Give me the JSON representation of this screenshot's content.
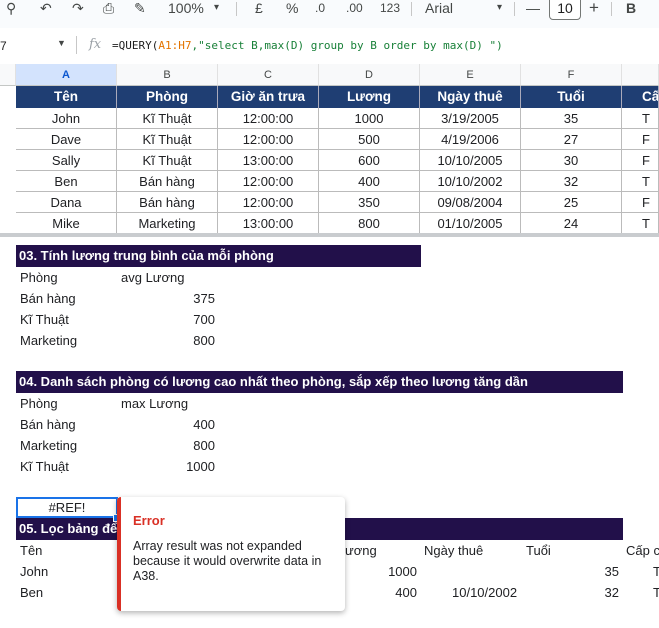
{
  "toolbar": {
    "zoom": "100%",
    "currency": "£",
    "percent": "%",
    "dec_decrease": ".0",
    "dec_increase": ".00",
    "number_format": "123",
    "font": "Arial",
    "font_size": "10",
    "minus": "—",
    "plus": "+",
    "bold": "B"
  },
  "formula_bar": {
    "name_box": "7",
    "fx": "fx",
    "formula_prefix": "=QUERY(",
    "formula_range": "A1:H7",
    "formula_string": ",\"select B,max(D) group by B order by max(D) \")"
  },
  "columns": [
    "A",
    "B",
    "C",
    "D",
    "E",
    "F"
  ],
  "table": {
    "headers": [
      "Tên",
      "Phòng",
      "Giờ ăn trưa",
      "Lương",
      "Ngày thuê",
      "Tuổi",
      "Cấ"
    ],
    "rows": [
      [
        "John",
        "Kĩ Thuật",
        "12:00:00",
        "1000",
        "3/19/2005",
        "35",
        "T"
      ],
      [
        "Dave",
        "Kĩ Thuật",
        "12:00:00",
        "500",
        "4/19/2006",
        "27",
        "F"
      ],
      [
        "Sally",
        "Kĩ Thuật",
        "13:00:00",
        "600",
        "10/10/2005",
        "30",
        "F"
      ],
      [
        "Ben",
        "Bán hàng",
        "12:00:00",
        "400",
        "10/10/2002",
        "32",
        "T"
      ],
      [
        "Dana",
        "Bán hàng",
        "12:00:00",
        "350",
        "09/08/2004",
        "25",
        "F"
      ],
      [
        "Mike",
        "Marketing",
        "13:00:00",
        "800",
        "01/10/2005",
        "24",
        "T"
      ]
    ]
  },
  "section3": {
    "title": "03. Tính lương trung bình của mỗi phòng",
    "col1": "Phòng",
    "col2": "avg Lương",
    "rows": [
      [
        "Bán hàng",
        "375"
      ],
      [
        "Kĩ Thuật",
        "700"
      ],
      [
        "Marketing",
        "800"
      ]
    ]
  },
  "section4": {
    "title": "04. Danh sách phòng có lương cao nhất theo phòng, sắp xếp theo lương tăng dần",
    "col1": "Phòng",
    "col2": "max Lương",
    "rows": [
      [
        "Bán hàng",
        "400"
      ],
      [
        "Marketing",
        "800"
      ],
      [
        "Kĩ Thuật",
        "1000"
      ]
    ]
  },
  "ref_cell": "#REF!",
  "section5": {
    "title": "05. Lọc bảng để",
    "headers": [
      "Tên",
      "ương",
      "Ngày thuê",
      "Tuổi",
      "Cấp c"
    ],
    "rows": [
      [
        "John",
        "1000",
        "",
        "35",
        "T"
      ],
      [
        "Ben",
        "400",
        "10/10/2002",
        "32",
        "T"
      ]
    ]
  },
  "error_popup": {
    "title": "Error",
    "message": "Array result was not expanded because it would overwrite data in A38."
  },
  "colors": {
    "header_blue": "#1f3e73",
    "banner_purple": "#22104a",
    "error_red": "#d93025",
    "selection_blue": "#1a73e8"
  }
}
